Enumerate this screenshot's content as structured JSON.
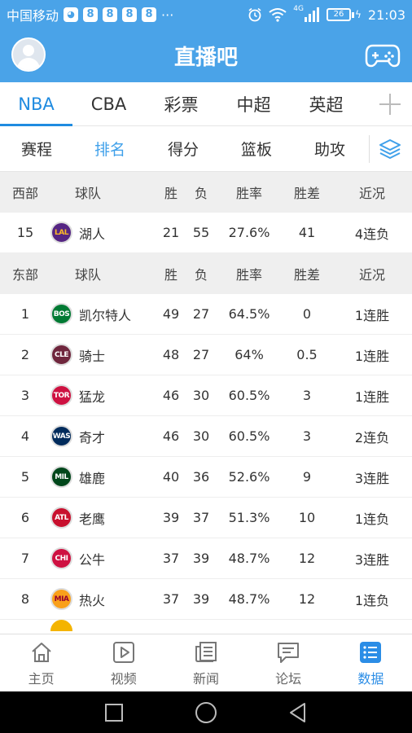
{
  "status_bar": {
    "carrier": "中国移动",
    "dots": "···",
    "network": "4G",
    "battery": "26",
    "time": "21:03"
  },
  "header": {
    "title": "直播吧"
  },
  "league_tabs": [
    {
      "label": "NBA",
      "active": true
    },
    {
      "label": "CBA",
      "active": false
    },
    {
      "label": "彩票",
      "active": false
    },
    {
      "label": "中超",
      "active": false
    },
    {
      "label": "英超",
      "active": false
    }
  ],
  "sub_tabs": [
    {
      "label": "赛程",
      "active": false
    },
    {
      "label": "排名",
      "active": true
    },
    {
      "label": "得分",
      "active": false
    },
    {
      "label": "篮板",
      "active": false
    },
    {
      "label": "助攻",
      "active": false
    }
  ],
  "west": {
    "header": {
      "conf": "西部",
      "team": "球队",
      "w": "胜",
      "l": "负",
      "pct": "胜率",
      "gb": "胜差",
      "streak": "近况"
    },
    "rows": [
      {
        "rank": "15",
        "abbr": "LAL",
        "logo_color": "#552583",
        "logo_text_color": "#fdb927",
        "team": "湖人",
        "w": "21",
        "l": "55",
        "pct": "27.6%",
        "gb": "41",
        "streak": "4连负"
      }
    ]
  },
  "east": {
    "header": {
      "conf": "东部",
      "team": "球队",
      "w": "胜",
      "l": "负",
      "pct": "胜率",
      "gb": "胜差",
      "streak": "近况"
    },
    "rows": [
      {
        "rank": "1",
        "abbr": "BOS",
        "logo_color": "#007a33",
        "logo_text_color": "#ffffff",
        "team": "凯尔特人",
        "w": "49",
        "l": "27",
        "pct": "64.5%",
        "gb": "0",
        "streak": "1连胜"
      },
      {
        "rank": "2",
        "abbr": "CLE",
        "logo_color": "#6f263d",
        "logo_text_color": "#ffffff",
        "team": "骑士",
        "w": "48",
        "l": "27",
        "pct": "64%",
        "gb": "0.5",
        "streak": "1连胜"
      },
      {
        "rank": "3",
        "abbr": "TOR",
        "logo_color": "#ce1141",
        "logo_text_color": "#ffffff",
        "team": "猛龙",
        "w": "46",
        "l": "30",
        "pct": "60.5%",
        "gb": "3",
        "streak": "1连胜"
      },
      {
        "rank": "4",
        "abbr": "WAS",
        "logo_color": "#002b5c",
        "logo_text_color": "#ffffff",
        "team": "奇才",
        "w": "46",
        "l": "30",
        "pct": "60.5%",
        "gb": "3",
        "streak": "2连负"
      },
      {
        "rank": "5",
        "abbr": "MIL",
        "logo_color": "#00471b",
        "logo_text_color": "#ffffff",
        "team": "雄鹿",
        "w": "40",
        "l": "36",
        "pct": "52.6%",
        "gb": "9",
        "streak": "3连胜"
      },
      {
        "rank": "6",
        "abbr": "ATL",
        "logo_color": "#c8102e",
        "logo_text_color": "#ffffff",
        "team": "老鹰",
        "w": "39",
        "l": "37",
        "pct": "51.3%",
        "gb": "10",
        "streak": "1连负"
      },
      {
        "rank": "7",
        "abbr": "CHI",
        "logo_color": "#ce1141",
        "logo_text_color": "#ffffff",
        "team": "公牛",
        "w": "37",
        "l": "39",
        "pct": "48.7%",
        "gb": "12",
        "streak": "3连胜"
      },
      {
        "rank": "8",
        "abbr": "MIA",
        "logo_color": "#f9a01b",
        "logo_text_color": "#98002e",
        "team": "热火",
        "w": "37",
        "l": "39",
        "pct": "48.7%",
        "gb": "12",
        "streak": "1连负"
      }
    ]
  },
  "bottom_nav": [
    {
      "label": "主页",
      "icon": "home-icon",
      "active": false
    },
    {
      "label": "视频",
      "icon": "video-icon",
      "active": false
    },
    {
      "label": "新闻",
      "icon": "news-icon",
      "active": false
    },
    {
      "label": "论坛",
      "icon": "forum-icon",
      "active": false
    },
    {
      "label": "数据",
      "icon": "data-icon",
      "active": true
    }
  ],
  "colors": {
    "brand": "#4aa3e8",
    "active_tab": "#1f8be0",
    "active_nav": "#2b8de6"
  }
}
